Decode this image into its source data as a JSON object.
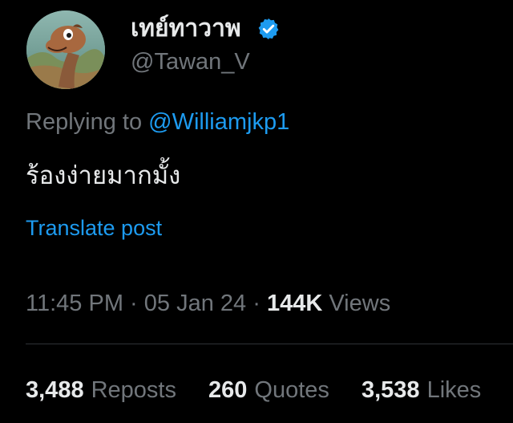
{
  "author": {
    "display_name": "เทย์ทาวาพ",
    "handle": "@Tawan_V",
    "verified_icon": "verified-badge-icon",
    "avatar_icon": "cartoon-dinosaur-avatar"
  },
  "reply": {
    "prefix": "Replying to",
    "mention": "@Williamjkp1"
  },
  "post": {
    "text": "ร้องง่ายมากมั้ง",
    "translate_label": "Translate post"
  },
  "meta": {
    "time": "11:45 PM",
    "separator": "·",
    "date": "05 Jan 24",
    "views_count": "144K",
    "views_label": "Views"
  },
  "stats": {
    "reposts_count": "3,488",
    "reposts_label": "Reposts",
    "quotes_count": "260",
    "quotes_label": "Quotes",
    "likes_count": "3,538",
    "likes_label": "Likes"
  },
  "colors": {
    "background": "#000000",
    "primary_text": "#e7e9ea",
    "secondary_text": "#71767b",
    "accent": "#1d9bf0",
    "divider": "#2f3336"
  }
}
